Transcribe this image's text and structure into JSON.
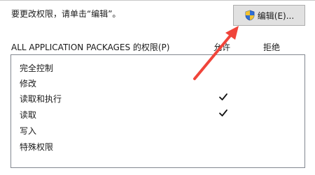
{
  "instruction": "要更改权限，请单击“编辑”。",
  "edit_button": {
    "label": "编辑(E)...",
    "icon": "uac-shield-icon"
  },
  "permissions": {
    "title": "ALL APPLICATION PACKAGES 的权限(P)",
    "allow_header": "允许",
    "deny_header": "拒绝",
    "rows": [
      {
        "label": "完全控制",
        "allow": false,
        "deny": false
      },
      {
        "label": "修改",
        "allow": false,
        "deny": false
      },
      {
        "label": "读取和执行",
        "allow": true,
        "deny": false
      },
      {
        "label": "读取",
        "allow": true,
        "deny": false
      },
      {
        "label": "写入",
        "allow": false,
        "deny": false
      },
      {
        "label": "特殊权限",
        "allow": false,
        "deny": false
      }
    ]
  },
  "colors": {
    "annotation_arrow": "#f0443a",
    "button_bg": "#e1e1e1"
  }
}
